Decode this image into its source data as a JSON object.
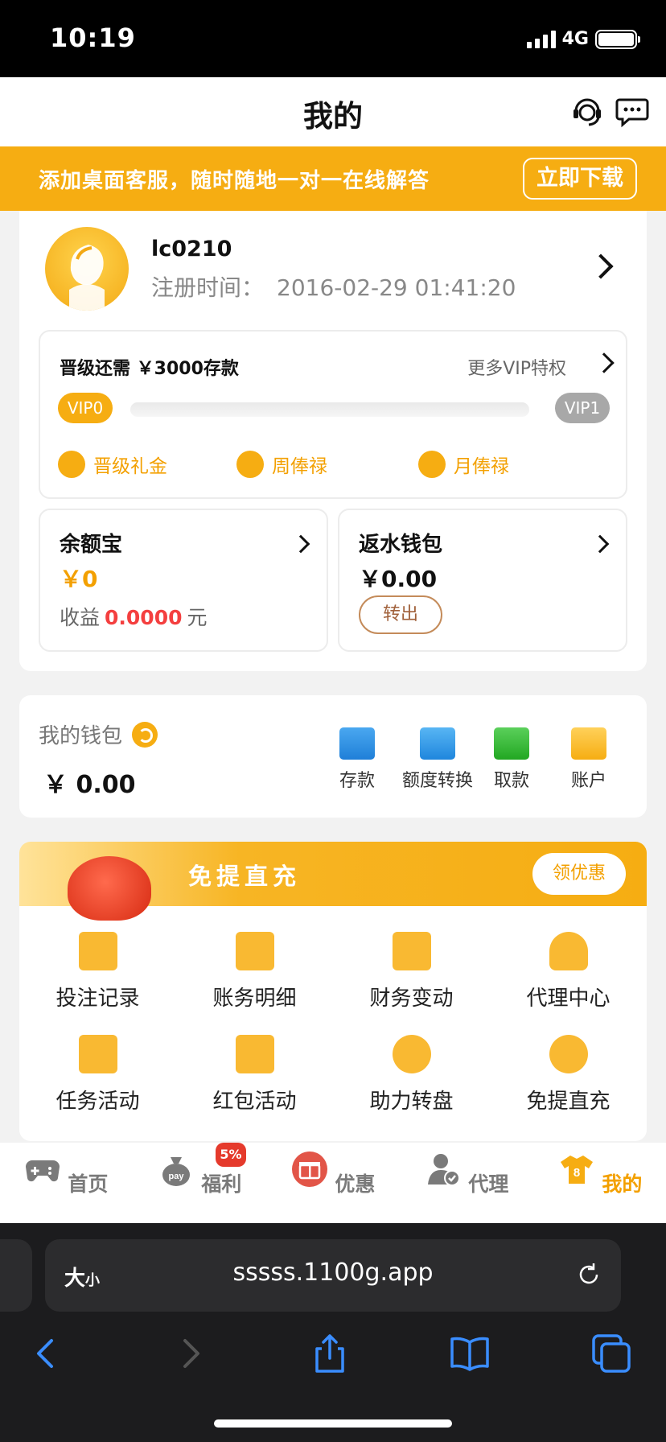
{
  "status": {
    "time": "10:19",
    "network": "4G"
  },
  "header": {
    "title": "我的"
  },
  "banner": {
    "text": "添加桌面客服，随时随地一对一在线解答",
    "button": "立即下载"
  },
  "profile": {
    "username": "lc0210",
    "reg_label": "注册时间：",
    "reg_time": "2016-02-29 01:41:20"
  },
  "vip": {
    "need": "晋级还需 ￥3000存款",
    "more": "更多VIP特权",
    "from": "VIP0",
    "to": "VIP1",
    "progress": 0,
    "perks": [
      "晋级礼金",
      "周俸禄",
      "月俸禄"
    ]
  },
  "yuebao": {
    "title": "余额宝",
    "amount": "￥0",
    "earn_label": "收益",
    "earn_value": "0.0000",
    "earn_unit": "元"
  },
  "rebate": {
    "title": "返水钱包",
    "amount": "￥0.00",
    "button": "转出"
  },
  "wallet": {
    "title": "我的钱包",
    "balance": "￥ 0.00",
    "actions": [
      "存款",
      "额度转换",
      "取款",
      "账户"
    ]
  },
  "promo": {
    "text": "免提直充",
    "button": "领优惠"
  },
  "grid": [
    "投注记录",
    "账务明细",
    "财务变动",
    "代理中心",
    "任务活动",
    "红包活动",
    "助力转盘",
    "免提直充"
  ],
  "tabbar": {
    "tabs": [
      "首页",
      "福利",
      "优惠",
      "代理",
      "我的"
    ],
    "active": 4,
    "badge": "5%",
    "pay_text": "pay"
  },
  "browser": {
    "text_size_label": "大",
    "text_size_small": "小",
    "url": "sssss.1100g.app"
  },
  "colors": {
    "accent": "#f6ad12",
    "red": "#f43f3f",
    "tab_active": "#f3a000"
  }
}
